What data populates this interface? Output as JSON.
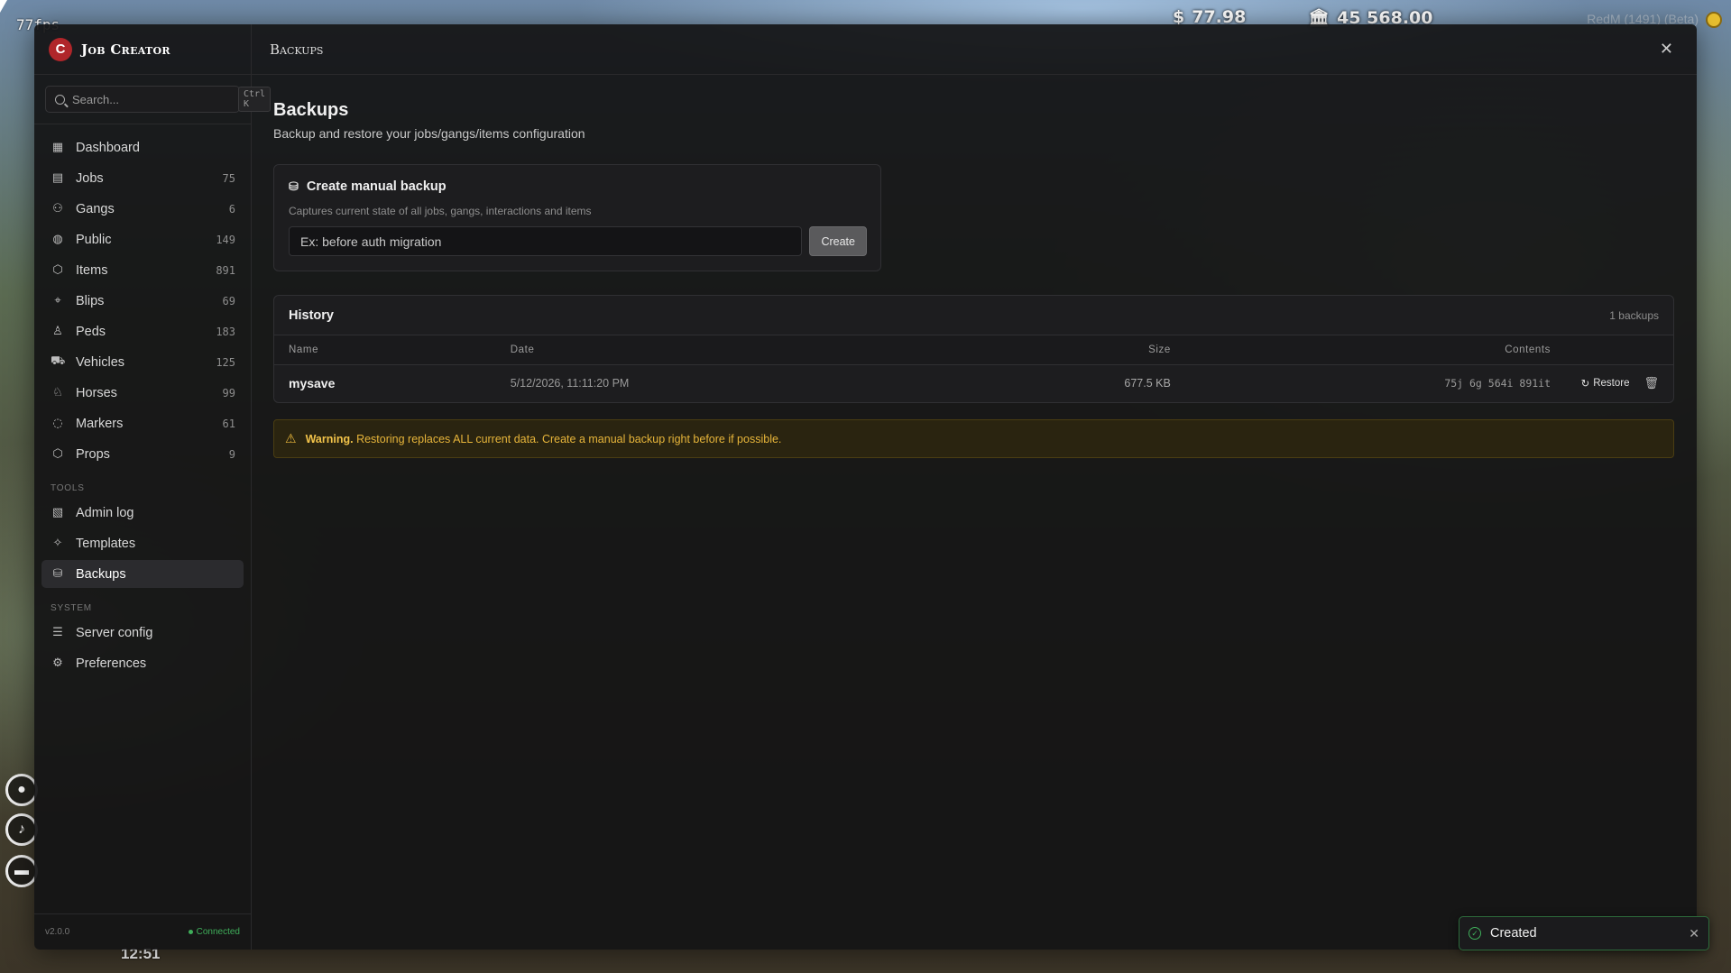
{
  "hud": {
    "fps": "77fps",
    "cash": "77.98",
    "cash_symbol": "$",
    "bank": "45 568.00",
    "bank_symbol": "🏛",
    "server": "RedM (1491) (Beta)",
    "time": "12:51"
  },
  "brand": {
    "logo_letter": "C",
    "name": "Job Creator"
  },
  "search": {
    "placeholder": "Search...",
    "shortcut": "Ctrl K"
  },
  "nav": {
    "items": [
      {
        "icon": "dashboard-icon",
        "glyph": "▦",
        "label": "Dashboard",
        "count": ""
      },
      {
        "icon": "briefcase-icon",
        "glyph": "▤",
        "label": "Jobs",
        "count": "75"
      },
      {
        "icon": "users-icon",
        "glyph": "⚇",
        "label": "Gangs",
        "count": "6"
      },
      {
        "icon": "globe-icon",
        "glyph": "◍",
        "label": "Public",
        "count": "149"
      },
      {
        "icon": "box-icon",
        "glyph": "⬡",
        "label": "Items",
        "count": "891"
      },
      {
        "icon": "map-pin-icon",
        "glyph": "⌖",
        "label": "Blips",
        "count": "69"
      },
      {
        "icon": "person-icon",
        "glyph": "♙",
        "label": "Peds",
        "count": "183"
      },
      {
        "icon": "car-icon",
        "glyph": "⛟",
        "label": "Vehicles",
        "count": "125"
      },
      {
        "icon": "person-icon",
        "glyph": "♘",
        "label": "Horses",
        "count": "99"
      },
      {
        "icon": "marker-icon",
        "glyph": "◌",
        "label": "Markers",
        "count": "61"
      },
      {
        "icon": "box-icon",
        "glyph": "⬡",
        "label": "Props",
        "count": "9"
      }
    ],
    "tools_label": "Tools",
    "tools": [
      {
        "icon": "scroll-icon",
        "glyph": "▧",
        "label": "Admin log"
      },
      {
        "icon": "sparkles-icon",
        "glyph": "✧",
        "label": "Templates"
      },
      {
        "icon": "database-icon",
        "glyph": "⛁",
        "label": "Backups",
        "active": true
      }
    ],
    "system_label": "System",
    "system": [
      {
        "icon": "sliders-icon",
        "glyph": "☰",
        "label": "Server config"
      },
      {
        "icon": "gear-icon",
        "glyph": "⚙",
        "label": "Preferences"
      }
    ]
  },
  "footer": {
    "version": "v2.0.0",
    "status": "Connected"
  },
  "topbar": {
    "title": "Backups",
    "close": "✕"
  },
  "page": {
    "title": "Backups",
    "subtitle": "Backup and restore your jobs/gangs/items configuration"
  },
  "create": {
    "title": "Create manual backup",
    "description": "Captures current state of all jobs, gangs, interactions and items",
    "input_placeholder": "Ex: before auth migration",
    "input_value": "",
    "button": "Create"
  },
  "history": {
    "title": "History",
    "count": "1 backups",
    "columns": [
      "Name",
      "Date",
      "Size",
      "Contents"
    ],
    "rows": [
      {
        "name": "mysave",
        "date": "5/12/2026, 11:11:20 PM",
        "size": "677.5 KB",
        "contents": "75j 6g 564i 891it",
        "restore_label": "Restore"
      }
    ]
  },
  "warning": {
    "strong": "Warning.",
    "text": "Restoring replaces ALL current data. Create a manual backup right before if possible."
  },
  "toast": {
    "text": "Created"
  },
  "colors": {
    "accent_green": "#3fae5a",
    "warning_amber": "#e7b53a",
    "brand_red": "#b0262a"
  }
}
